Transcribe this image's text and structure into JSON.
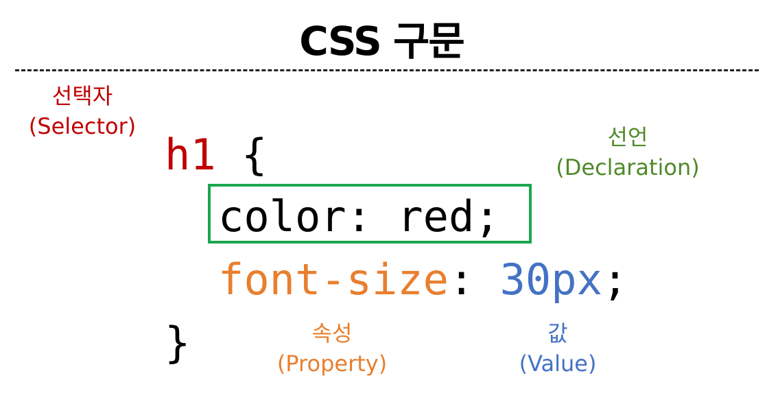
{
  "title": "CSS 구문",
  "colors": {
    "selector": "#c00000",
    "declaration_label": "#4f8a2a",
    "declaration_box": "#1aa64f",
    "property": "#e87f2f",
    "value": "#4472c4",
    "punctuation": "#000000"
  },
  "annotations": {
    "selector": {
      "label": "선택자",
      "sublabel": "(Selector)"
    },
    "declaration": {
      "label": "선언",
      "sublabel": "(Declaration)"
    },
    "property": {
      "label": "속성",
      "sublabel": "(Property)"
    },
    "value": {
      "label": "값",
      "sublabel": "(Value)"
    }
  },
  "code": {
    "selector": "h1",
    "open_brace": " {",
    "declaration1": "color: red;",
    "property": "font-size",
    "colon": ": ",
    "value": "30px",
    "semicolon": ";",
    "close_brace": "}"
  }
}
